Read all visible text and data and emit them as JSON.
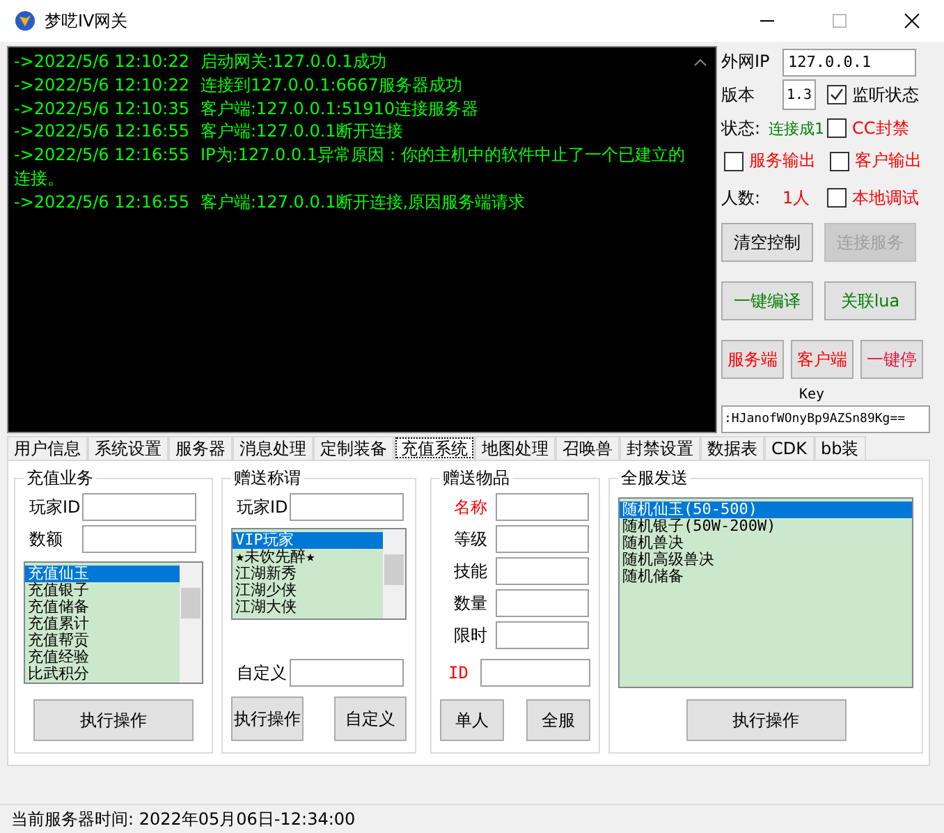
{
  "window": {
    "title": "梦呓IV网关"
  },
  "log": [
    {
      "time": "->2022/5/6 12:10:22",
      "message": "启动网关:127.0.0.1成功"
    },
    {
      "time": "->2022/5/6 12:10:22",
      "message": "连接到127.0.0.1:6667服务器成功"
    },
    {
      "time": "->2022/5/6 12:10:35",
      "message": "客户端:127.0.0.1:51910连接服务器"
    },
    {
      "time": "->2022/5/6 12:16:55",
      "message": "客户端:127.0.0.1断开连接"
    },
    {
      "time": "->2022/5/6 12:16:55",
      "message": "IP为:127.0.0.1异常原因：你的主机中的软件中止了一个已建立的",
      "continuation": "连接。"
    },
    {
      "time": "->2022/5/6 12:16:55",
      "message": "客户端:127.0.0.1断开连接,原因服务端请求"
    }
  ],
  "control": {
    "external_ip": {
      "label": "外网IP",
      "value": "127.0.0.1"
    },
    "version": {
      "label": "版本",
      "value": "1.3"
    },
    "monitor": {
      "label": "监听状态",
      "checked": true,
      "color": "#000000"
    },
    "status": {
      "label": "状态:",
      "value": "连接成1"
    },
    "cc_ban": {
      "label": "CC封禁",
      "checked": false,
      "color": "#ff0000"
    },
    "service_output": {
      "label": "服务输出",
      "checked": false,
      "color": "#ff0000"
    },
    "client_output": {
      "label": "客户输出",
      "checked": false,
      "color": "#ff0000"
    },
    "count": {
      "label": "人数:",
      "value": "1人"
    },
    "local_debug": {
      "label": "本地调试",
      "checked": false,
      "color": "#ff0000"
    },
    "buttons": [
      {
        "label": "清空控制",
        "color": "#000000",
        "disabled": false
      },
      {
        "label": "连接服务",
        "color": "#a0a0a0",
        "disabled": true
      },
      {
        "label": "一键编译",
        "color": "#008000",
        "disabled": false
      },
      {
        "label": "关联lua",
        "color": "#008000",
        "disabled": false
      },
      {
        "label": "服务端",
        "color": "#ff0000",
        "disabled": false
      },
      {
        "label": "客户端",
        "color": "#ff0000",
        "disabled": false
      },
      {
        "label": "一键停",
        "color": "#e0103c",
        "disabled": false
      }
    ],
    "key": {
      "label": "Key",
      "value": ":HJanofWOnyBp9AZSn89Kg=="
    }
  },
  "tabs": [
    {
      "label": "用户信息",
      "selected": false
    },
    {
      "label": "系统设置",
      "selected": false
    },
    {
      "label": "服务器",
      "selected": false
    },
    {
      "label": "消息处理",
      "selected": false
    },
    {
      "label": "定制装备",
      "selected": false
    },
    {
      "label": "充值系统",
      "selected": true
    },
    {
      "label": "地图处理",
      "selected": false
    },
    {
      "label": "召唤兽",
      "selected": false
    },
    {
      "label": "封禁设置",
      "selected": false
    },
    {
      "label": "数据表",
      "selected": false
    },
    {
      "label": "CDK",
      "selected": false
    },
    {
      "label": "bb装",
      "selected": false
    }
  ],
  "recharge": {
    "title": "充值业务",
    "fields": [
      {
        "label": "玩家ID"
      },
      {
        "label": "数额"
      }
    ],
    "list": [
      {
        "label": "充值仙玉",
        "selected": true
      },
      {
        "label": "充值银子",
        "selected": false
      },
      {
        "label": "充值储备",
        "selected": false
      },
      {
        "label": "充值累计",
        "selected": false
      },
      {
        "label": "充值帮贡",
        "selected": false
      },
      {
        "label": "充值经验",
        "selected": false
      },
      {
        "label": "比武积分",
        "selected": false
      }
    ],
    "button": "执行操作"
  },
  "title_gift": {
    "title": "赠送称谓",
    "field": {
      "label": "玩家ID"
    },
    "list": [
      {
        "label": "VIP玩家",
        "selected": true
      },
      {
        "label": "★未饮先醉★",
        "selected": false
      },
      {
        "label": "江湖新秀",
        "selected": false
      },
      {
        "label": "江湖少侠",
        "selected": false
      },
      {
        "label": "江湖大侠",
        "selected": false
      }
    ],
    "custom": {
      "label": "自定义"
    },
    "buttons": [
      "执行操作",
      "自定义"
    ]
  },
  "item_gift": {
    "title": "赠送物品",
    "fields": [
      {
        "label": "名称",
        "color": "#ff0000"
      },
      {
        "label": "等级",
        "color": "#000000"
      },
      {
        "label": "技能",
        "color": "#000000"
      },
      {
        "label": "数量",
        "color": "#000000"
      },
      {
        "label": "限时",
        "color": "#000000"
      }
    ],
    "id": {
      "label": "ID"
    },
    "buttons": [
      "单人",
      "全服"
    ]
  },
  "server_send": {
    "title": "全服发送",
    "list": [
      {
        "label": "随机仙玉(50-500)",
        "selected": true
      },
      {
        "label": "随机银子(50W-200W)",
        "selected": false
      },
      {
        "label": "随机兽决",
        "selected": false
      },
      {
        "label": "随机高级兽决",
        "selected": false
      },
      {
        "label": "随机储备",
        "selected": false
      }
    ],
    "button": "执行操作"
  },
  "status_bar": {
    "text": "当前服务器时间:  2022年05月06日-12:34:00"
  }
}
